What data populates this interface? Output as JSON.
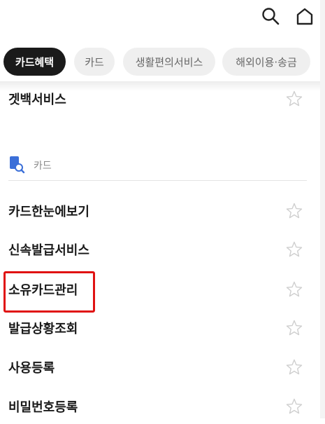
{
  "header": {
    "icons": [
      "search-icon",
      "home-icon"
    ]
  },
  "tabs": [
    {
      "label": "카드혜택",
      "active": true
    },
    {
      "label": "카드",
      "active": false
    },
    {
      "label": "생활편의서비스",
      "active": false
    },
    {
      "label": "해외이용·송금",
      "active": false
    }
  ],
  "prev_item": {
    "label": "겟백서비스"
  },
  "section": {
    "label": "카드",
    "icon": "card-search-icon"
  },
  "items": [
    {
      "label": "카드한눈에보기"
    },
    {
      "label": "신속발급서비스"
    },
    {
      "label": "소유카드관리",
      "highlighted": true
    },
    {
      "label": "발급상황조회"
    },
    {
      "label": "사용등록"
    },
    {
      "label": "비밀번호등록"
    }
  ],
  "colors": {
    "active_tab_bg": "#1a1a1a",
    "inactive_tab_bg": "#efefef",
    "highlight_border": "#e01212",
    "section_icon": "#3b6fd8"
  }
}
